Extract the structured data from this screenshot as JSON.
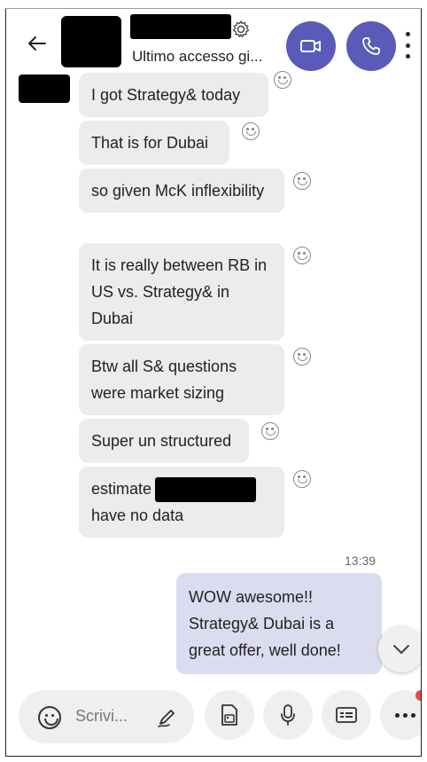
{
  "header": {
    "status_text": "Ultimo accesso gi...",
    "accent_color": "#5a5bb8"
  },
  "messages": [
    {
      "text": "I got Strategy& today"
    },
    {
      "text": "That is for Dubai"
    },
    {
      "text": "so given McK inflexibility"
    },
    {
      "text": "It is really between RB in US vs. Strategy& in Dubai"
    },
    {
      "text": "Btw all S& questions were market sizing"
    },
    {
      "text": "Super un structured"
    },
    {
      "text_before": "estimate",
      "text_after": "have no data"
    }
  ],
  "outgoing": {
    "time": "13:39",
    "text": "WOW awesome!! Strategy& Dubai is a great offer, well done!"
  },
  "composer": {
    "placeholder": "Scrivi..."
  },
  "icons": {
    "back": "arrow-left-icon",
    "settings": "gear-icon",
    "video": "video-camera-icon",
    "call": "phone-icon",
    "menu": "more-vertical-icon",
    "reaction": "smiley-icon",
    "scroll": "chevron-down-icon",
    "emoji": "emoji-icon",
    "handwriting": "pen-icon",
    "gallery": "image-icon",
    "mic": "microphone-icon",
    "contact": "contact-card-icon",
    "more": "more-horizontal-icon"
  },
  "colors": {
    "incoming_bubble": "#ececec",
    "outgoing_bubble": "#dcdcf0",
    "notification_dot": "#e74c3c"
  }
}
